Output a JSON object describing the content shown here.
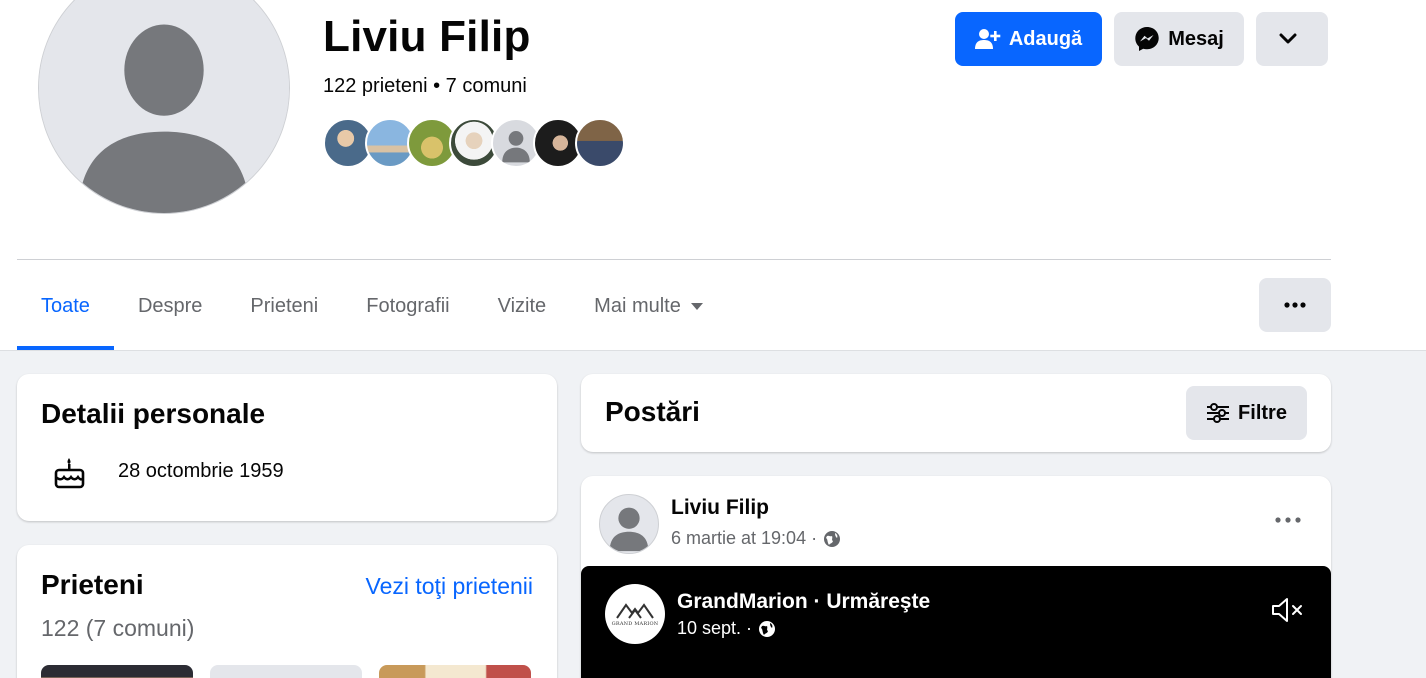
{
  "profile": {
    "name": "Liviu Filip",
    "friends_summary": "122 prieteni • 7 comuni",
    "friend_faces": [
      "#4a6a8a",
      "#6a9ac4",
      "#b7a24a",
      "#3c4a3a",
      "#d8dadf",
      "#2a2a2a",
      "#6a5030"
    ]
  },
  "actions": {
    "add_label": "Adaugă",
    "message_label": "Mesaj"
  },
  "tabs": [
    {
      "label": "Toate",
      "active": true
    },
    {
      "label": "Despre"
    },
    {
      "label": "Prieteni"
    },
    {
      "label": "Fotografii"
    },
    {
      "label": "Vizite"
    },
    {
      "label": "Mai multe"
    }
  ],
  "details": {
    "title": "Detalii personale",
    "birthday": "28 octombrie 1959"
  },
  "friends_card": {
    "title": "Prieteni",
    "see_all": "Vezi toţi prietenii",
    "subtitle": "122 (7 comuni)"
  },
  "posts": {
    "title": "Postări",
    "filter_label": "Filtre"
  },
  "post": {
    "author": "Liviu Filip",
    "time": "6 martie at 19:04 ·",
    "shared": {
      "title": "GrandMarion · Urmăreşte",
      "time": "10 sept. ·",
      "logo_text": "GRAND MARION"
    }
  },
  "colors": {
    "accent": "#0866ff",
    "secondary_button": "#e4e6eb",
    "feed_background": "#f0f2f5",
    "muted_text": "#65676b"
  }
}
